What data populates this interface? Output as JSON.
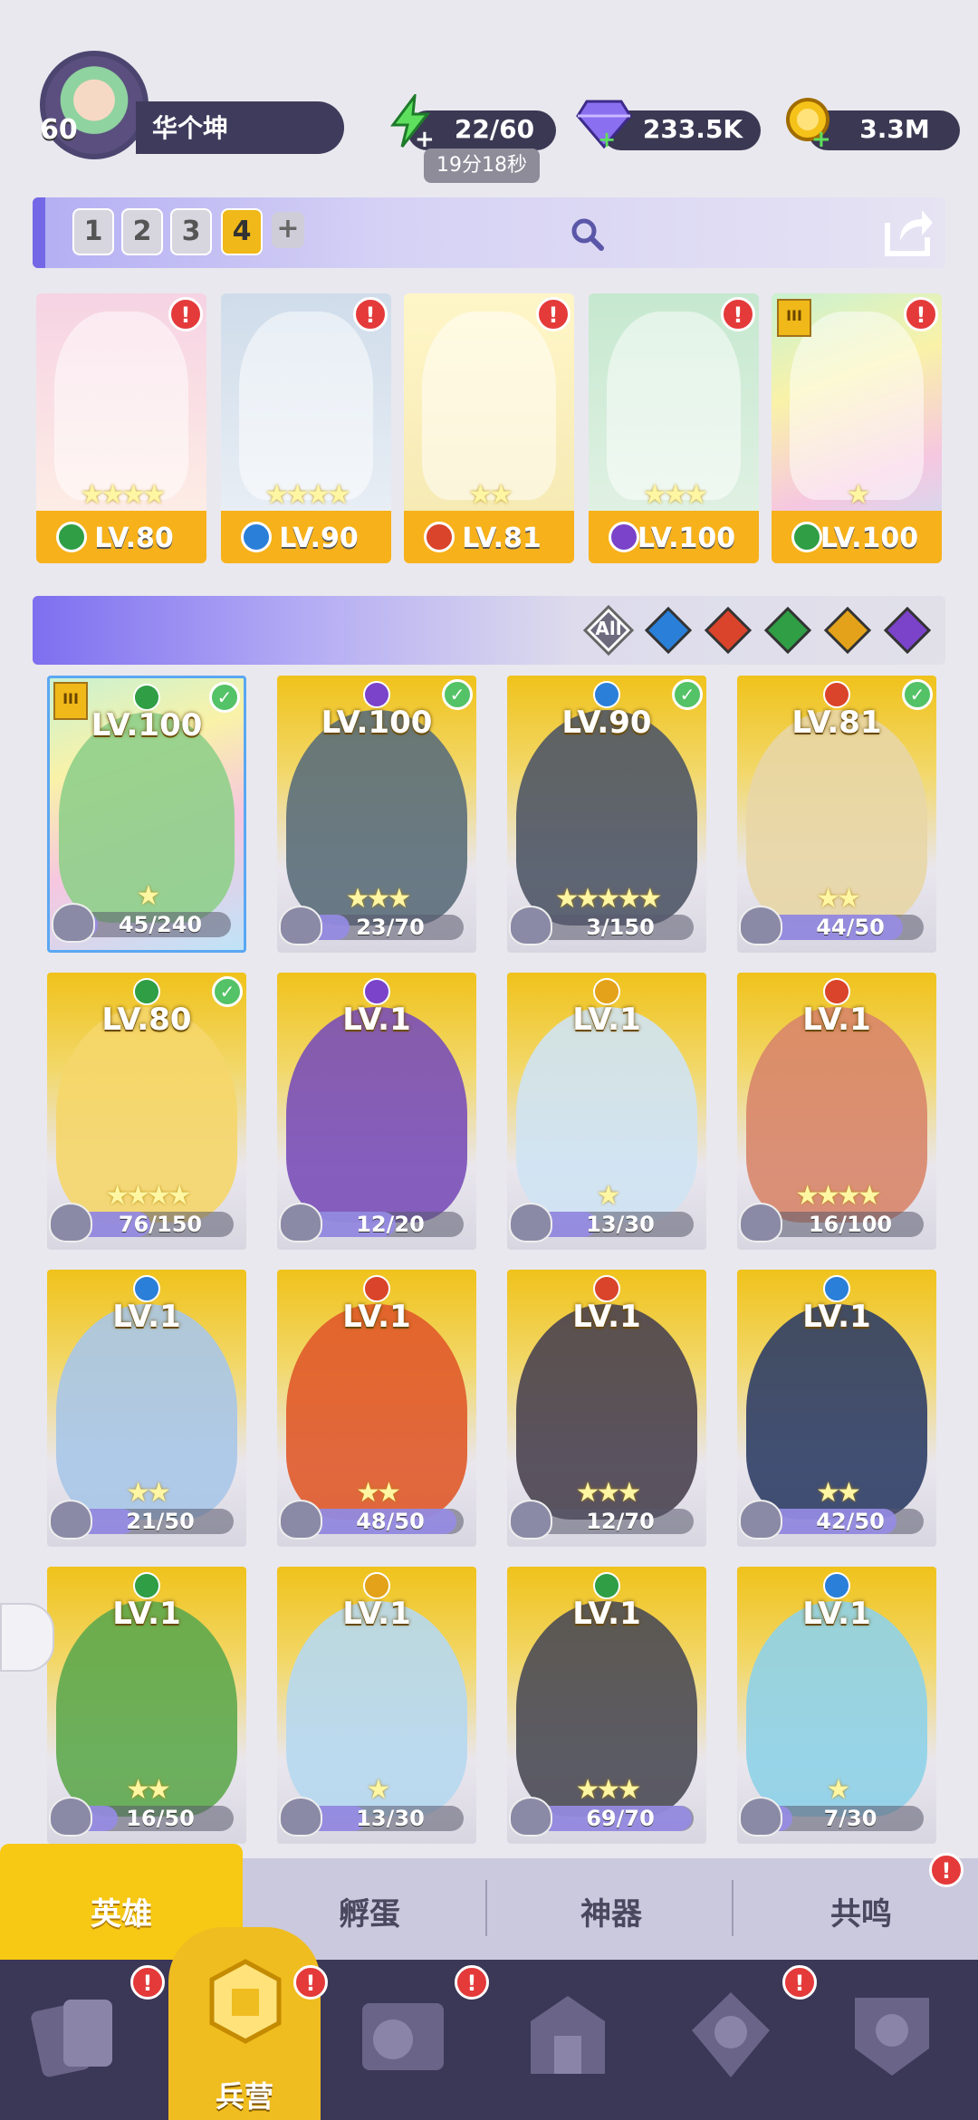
{
  "player": {
    "level": "60",
    "name": "华个坤"
  },
  "resources": {
    "energy": "22/60",
    "energy_timer": "19分18秒",
    "gems": "233.5K",
    "coins": "3.3M"
  },
  "teams": {
    "tabs": [
      "1",
      "2",
      "3",
      "4"
    ],
    "active": "4",
    "add_label": "+"
  },
  "team_cards": [
    {
      "level": "LV.80",
      "element": "wind",
      "stars": "★★★★",
      "alert": "!"
    },
    {
      "level": "LV.90",
      "element": "water",
      "stars": "★★★★",
      "alert": "!"
    },
    {
      "level": "LV.81",
      "element": "fire",
      "stars": "★★",
      "alert": "!"
    },
    {
      "level": "LV.100",
      "element": "dark",
      "stars": "★★★",
      "alert": "!"
    },
    {
      "level": "LV.100",
      "element": "wind",
      "stars": "★",
      "alert": "!",
      "rank": "III"
    }
  ],
  "filters": {
    "all_label": "All",
    "elements": [
      "water",
      "fire",
      "wind",
      "light",
      "dark"
    ]
  },
  "element_colors": {
    "wind": "#2f9e45",
    "water": "#2a7fd8",
    "fire": "#d9442a",
    "dark": "#7a43c9",
    "light": "#e3a21a"
  },
  "heroes": [
    {
      "level": "LV.100",
      "element": "wind",
      "stars": "★",
      "progress": "45/240",
      "fraction": 0.19,
      "checked": true,
      "rank": "III",
      "art": "#8fcf8a"
    },
    {
      "level": "LV.100",
      "element": "dark",
      "stars": "★★★",
      "progress": "23/70",
      "fraction": 0.33,
      "checked": true,
      "art": "#5b6e7a"
    },
    {
      "level": "LV.90",
      "element": "water",
      "stars": "★★★★★",
      "progress": "3/150",
      "fraction": 0.02,
      "checked": true,
      "art": "#4f5666"
    },
    {
      "level": "LV.81",
      "element": "fire",
      "stars": "★★",
      "progress": "44/50",
      "fraction": 0.88,
      "checked": true,
      "art": "#e8d6a6"
    },
    {
      "level": "LV.80",
      "element": "wind",
      "stars": "★★★★",
      "progress": "76/150",
      "fraction": 0.51,
      "checked": true,
      "art": "#f5d66a"
    },
    {
      "level": "LV.1",
      "element": "dark",
      "stars": "",
      "progress": "12/20",
      "fraction": 0.6,
      "checked": false,
      "art": "#7a4fb8"
    },
    {
      "level": "LV.1",
      "element": "light",
      "stars": "★",
      "progress": "13/30",
      "fraction": 0.43,
      "checked": false,
      "art": "#cfe3f3"
    },
    {
      "level": "LV.1",
      "element": "fire",
      "stars": "★★★★",
      "progress": "16/100",
      "fraction": 0.16,
      "checked": false,
      "art": "#d8866a"
    },
    {
      "level": "LV.1",
      "element": "water",
      "stars": "★★",
      "progress": "21/50",
      "fraction": 0.42,
      "checked": false,
      "art": "#a9c7e8"
    },
    {
      "level": "LV.1",
      "element": "fire",
      "stars": "★★",
      "progress": "48/50",
      "fraction": 0.96,
      "checked": false,
      "art": "#e05a2a"
    },
    {
      "level": "LV.1",
      "element": "fire",
      "stars": "★★★",
      "progress": "12/70",
      "fraction": 0.17,
      "checked": false,
      "art": "#4a4250"
    },
    {
      "level": "LV.1",
      "element": "water",
      "stars": "★★",
      "progress": "42/50",
      "fraction": 0.84,
      "checked": false,
      "art": "#2f3e66"
    },
    {
      "level": "LV.1",
      "element": "wind",
      "stars": "★★",
      "progress": "16/50",
      "fraction": 0.32,
      "checked": false,
      "art": "#5ea94e"
    },
    {
      "level": "LV.1",
      "element": "light",
      "stars": "★",
      "progress": "13/30",
      "fraction": 0.43,
      "checked": false,
      "art": "#b6d8ef"
    },
    {
      "level": "LV.1",
      "element": "wind",
      "stars": "★★★",
      "progress": "69/70",
      "fraction": 0.99,
      "checked": false,
      "art": "#4b4b55"
    },
    {
      "level": "LV.1",
      "element": "water",
      "stars": "★",
      "progress": "7/30",
      "fraction": 0.23,
      "checked": false,
      "art": "#8fd2e8"
    }
  ],
  "tabs": {
    "heroes": "英雄",
    "hatch": "孵蛋",
    "artifact": "神器",
    "resonance": "共鸣"
  },
  "nav": {
    "barracks": "兵营"
  }
}
